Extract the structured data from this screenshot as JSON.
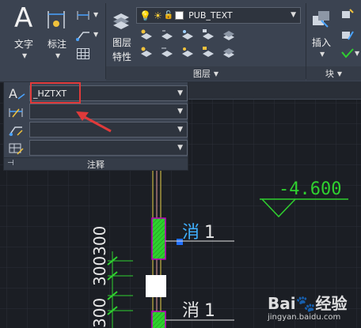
{
  "ribbon": {
    "text_label": "文字",
    "dim_label": "标注",
    "layer_props_line1": "图层",
    "layer_props_line2": "特性",
    "layer_combo_value": "PUB_TEXT",
    "layers_panel_title": "图层",
    "insert_label": "插入",
    "block_panel_title": "块"
  },
  "annotation_panel": {
    "rows": [
      "_HZTXT",
      "",
      "",
      ""
    ],
    "footer_title": "注释"
  },
  "drawing": {
    "elevation_text": "-4.600",
    "hydrant_label_1": "消",
    "hydrant_num_1": "1",
    "hydrant_label_2": "消",
    "hydrant_num_2": "1",
    "vertical_dim_text": "300300",
    "vertical_dim_text_2": "300"
  },
  "watermark": {
    "brand": "Bai",
    "brand_mid": "经验",
    "url": "jingyan.baidu.com"
  },
  "colors": {
    "ribbon_bg": "#3b4351",
    "canvas_bg": "#1b1e24",
    "grid": "#2a2e35",
    "green": "#2fd12f",
    "magenta": "#c000c0",
    "cyan_text": "#3fd16a",
    "highlight": "#e03a3a"
  }
}
